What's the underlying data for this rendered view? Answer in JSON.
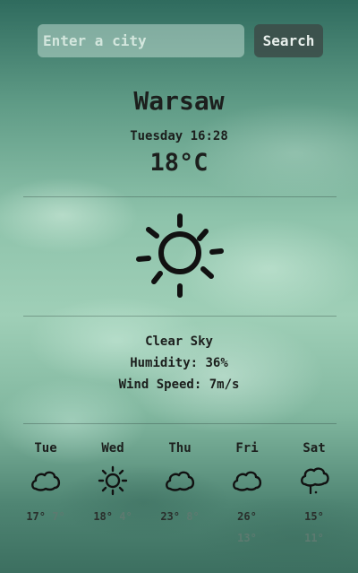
{
  "search": {
    "placeholder": "Enter a city",
    "value": "",
    "button_label": "Search"
  },
  "current": {
    "city": "Warsaw",
    "datetime": "Tuesday 16:28",
    "temperature": "18°C",
    "icon": "sun-icon",
    "description": "Clear Sky",
    "humidity": "Humidity: 36%",
    "wind": "Wind Speed: 7m/s"
  },
  "forecast": [
    {
      "day": "Tue",
      "icon": "cloud-icon",
      "high": "17°",
      "low": "7°"
    },
    {
      "day": "Wed",
      "icon": "sun-icon",
      "high": "18°",
      "low": "4°"
    },
    {
      "day": "Thu",
      "icon": "cloud-icon",
      "high": "23°",
      "low": "8°"
    },
    {
      "day": "Fri",
      "icon": "cloud-icon",
      "high": "26°",
      "low": "13°"
    },
    {
      "day": "Sat",
      "icon": "rain-cloud-icon",
      "high": "15°",
      "low": "11°"
    }
  ],
  "colors": {
    "text": "#1c1f1d",
    "button_bg": "#3c4b48",
    "low_temp": "#5d7a70"
  }
}
